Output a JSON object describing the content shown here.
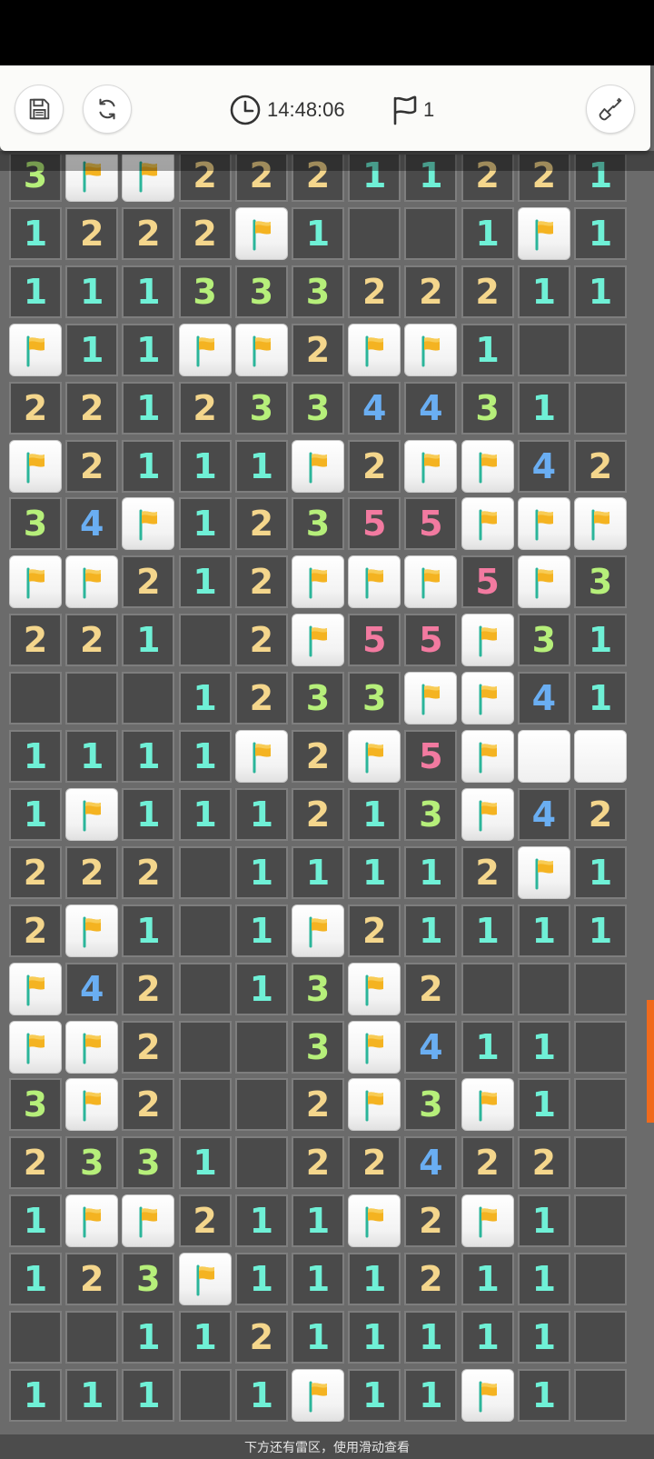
{
  "toolbar": {
    "save_icon": "save-icon",
    "restart_icon": "refresh-icon",
    "timer_icon": "clock-icon",
    "timer_value": "14:48:06",
    "flags_icon": "flag-outline-icon",
    "flags_count": "1",
    "mode_icon": "shovel-icon"
  },
  "colors": {
    "n1": "#6ff0d6",
    "n2": "#f4d68c",
    "n3": "#b6ef7a",
    "n4": "#6aaef2",
    "n5": "#f27aa0",
    "flag": "#f4b321"
  },
  "board": {
    "legend": "F = flagged cell, . = opened empty cell, C = closed (unrevealed) cell, digit = adjacent mine count",
    "rows": [
      "3FF222112 21",
      "1222F1..1F1",
      "11133322211",
      "F11FF2FF1..",
      "22123344 31.",
      "F2111F2FF42",
      "34F1235 5FFF",
      "FF212FFF5F3",
      "221.2F55F31",
      "...12 33FF41",
      "1111F2F5FCC",
      "1F11121 3F42",
      "222.11112F1",
      "2F1.1F21111",
      "F42.13F2...",
      "FF2..3F411.",
      "3F2..2F3F1.",
      "2331.22422.",
      "1FF211F2F1.",
      "123F1112 11.",
      "..11211111.",
      "111.1F11F1."
    ]
  },
  "hint_text": "下方还有雷区，使用滑动查看"
}
